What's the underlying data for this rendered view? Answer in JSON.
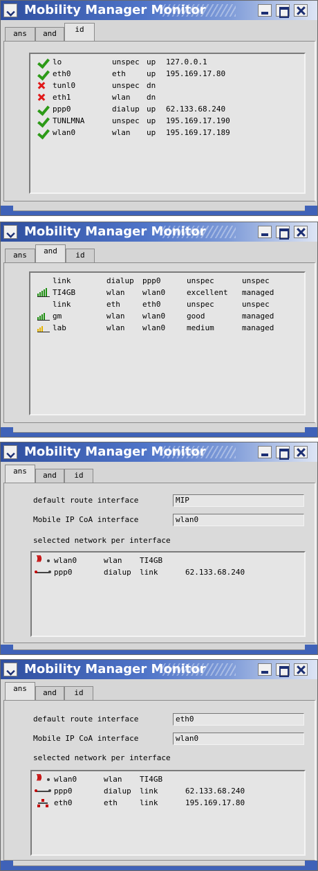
{
  "app_title": "Mobility Manager Monitor",
  "tabs": [
    "ans",
    "and",
    "id"
  ],
  "window1": {
    "interfaces": [
      {
        "status": "up",
        "name": "lo",
        "type": "unspec",
        "state": "up",
        "addr": "127.0.0.1"
      },
      {
        "status": "up",
        "name": "eth0",
        "type": "eth",
        "state": "up",
        "addr": "195.169.17.80"
      },
      {
        "status": "down",
        "name": "tunl0",
        "type": "unspec",
        "state": "dn",
        "addr": ""
      },
      {
        "status": "down",
        "name": "eth1",
        "type": "wlan",
        "state": "dn",
        "addr": ""
      },
      {
        "status": "up",
        "name": "ppp0",
        "type": "dialup",
        "state": "up",
        "addr": "62.133.68.240"
      },
      {
        "status": "up",
        "name": "TUNLMNA",
        "type": "unspec",
        "state": "up",
        "addr": "195.169.17.190"
      },
      {
        "status": "up",
        "name": "wlan0",
        "type": "wlan",
        "state": "up",
        "addr": "195.169.17.189"
      }
    ]
  },
  "window2": {
    "networks": [
      {
        "signal": "",
        "name": "link",
        "type": "dialup",
        "iface": "ppp0",
        "quality": "unspec",
        "mode": "unspec"
      },
      {
        "signal": "excellent",
        "name": "TI4GB",
        "type": "wlan",
        "iface": "wlan0",
        "quality": "excellent",
        "mode": "managed"
      },
      {
        "signal": "",
        "name": "link",
        "type": "eth",
        "iface": "eth0",
        "quality": "unspec",
        "mode": "unspec"
      },
      {
        "signal": "good",
        "name": "gm",
        "type": "wlan",
        "iface": "wlan0",
        "quality": "good",
        "mode": "managed"
      },
      {
        "signal": "medium",
        "name": "lab",
        "type": "wlan",
        "iface": "wlan0",
        "quality": "medium",
        "mode": "managed"
      }
    ]
  },
  "window3": {
    "default_route_label": "default route interface",
    "default_route_value": "MIP",
    "coa_label": "Mobile IP CoA interface",
    "coa_value": "wlan0",
    "selected_label": "selected network per interface",
    "selected": [
      {
        "icon": "wireless-icon",
        "iface": "wlan0",
        "type": "wlan",
        "network": "TI4GB",
        "addr": ""
      },
      {
        "icon": "dialup-icon",
        "iface": "ppp0",
        "type": "dialup",
        "network": "link",
        "addr": "62.133.68.240"
      }
    ]
  },
  "window4": {
    "default_route_label": "default route interface",
    "default_route_value": "eth0",
    "coa_label": "Mobile IP CoA interface",
    "coa_value": "wlan0",
    "selected_label": "selected network per interface",
    "selected": [
      {
        "icon": "wireless-icon",
        "iface": "wlan0",
        "type": "wlan",
        "network": "TI4GB",
        "addr": ""
      },
      {
        "icon": "dialup-icon",
        "iface": "ppp0",
        "type": "dialup",
        "network": "link",
        "addr": "62.133.68.240"
      },
      {
        "icon": "ethernet-icon",
        "iface": "eth0",
        "type": "eth",
        "network": "link",
        "addr": "195.169.17.80"
      }
    ]
  }
}
